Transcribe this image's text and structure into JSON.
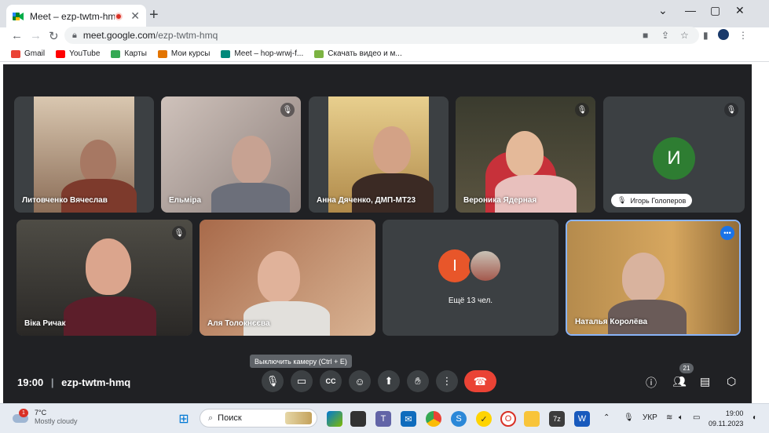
{
  "browser": {
    "tab_title": "Meet – ezp-twtm-hmq",
    "new_tab": "+",
    "url_domain": "meet.google.com",
    "url_path": "/ezp-twtm-hmq",
    "window_controls": [
      "⌄",
      "—",
      "▢",
      "✕"
    ]
  },
  "bookmarks": [
    {
      "label": "Gmail",
      "color": "#ea4335"
    },
    {
      "label": "YouTube",
      "color": "#ff0000"
    },
    {
      "label": "Карты",
      "color": "#34a853"
    },
    {
      "label": "Мои курсы",
      "color": "#e37400"
    },
    {
      "label": "Meet – hop-wrwj-f...",
      "color": "#00897b"
    },
    {
      "label": "Скачать видео и м...",
      "color": "#7cb342"
    }
  ],
  "participants": [
    {
      "name": "Литовченко Вячеслав",
      "muted": false
    },
    {
      "name": "Ельміра",
      "muted": true
    },
    {
      "name": "Анна Дяченко, ДМП-МТ23",
      "muted": false
    },
    {
      "name": "Вероника Ядерная",
      "muted": true
    },
    {
      "name": "Игорь Голоперов",
      "muted": true,
      "avatar_letter": "И",
      "avatar_color": "#2e7d32"
    },
    {
      "name": "Віка Ричак",
      "muted": true
    },
    {
      "name": "Аля Толокнєєва",
      "muted": false
    },
    {
      "name": "Наталья Королёва",
      "muted": false
    }
  ],
  "more_tile": {
    "label": "Ещё 13 чел.",
    "avatar_letter": "I",
    "avatar_color": "#e8562a"
  },
  "meeting": {
    "time": "19:00",
    "code": "ezp-twtm-hmq",
    "tooltip": "Выключить камеру (Ctrl + E)",
    "participant_count": "21"
  },
  "taskbar": {
    "temperature": "7°C",
    "weather": "Mostly cloudy",
    "weather_badge": "1",
    "search_placeholder": "Поиск",
    "language": "УКР",
    "time": "19:00",
    "date": "09.11.2023"
  }
}
